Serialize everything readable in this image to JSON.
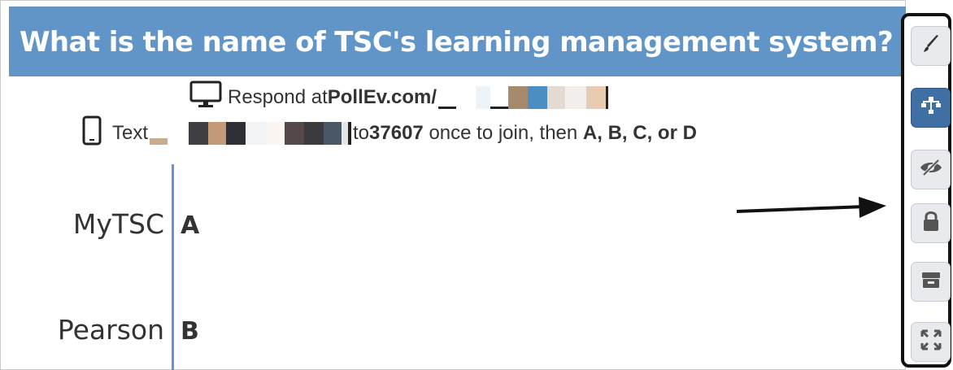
{
  "question": {
    "title": "What is the name of TSC's learning management system?"
  },
  "instructions": {
    "respond_prefix": "Respond at ",
    "respond_site": "PollEv.com/",
    "text_prefix": "Text",
    "text_number_prefix": "to ",
    "text_number": "37607",
    "text_join": " once to join, then ",
    "text_choices": "A, B, C, or D"
  },
  "chart_data": {
    "type": "bar",
    "categories": [
      "MyTSC",
      "Pearson"
    ],
    "letters": [
      "A",
      "B"
    ],
    "values": [
      0,
      0
    ],
    "title": "What is the name of TSC's learning management system?"
  },
  "toolbar": {
    "buttons": [
      {
        "name": "pencil-icon",
        "active": false
      },
      {
        "name": "network-icon",
        "active": true
      },
      {
        "name": "eye-slash-icon",
        "active": false
      },
      {
        "name": "lock-icon",
        "active": false
      },
      {
        "name": "archive-icon",
        "active": false
      },
      {
        "name": "fullscreen-icon",
        "active": false
      }
    ]
  },
  "colors": {
    "title_bar": "#6195c7",
    "axis": "#6b95c9",
    "active_tool": "#3f6fa3",
    "toolbar_border": "#111111"
  }
}
